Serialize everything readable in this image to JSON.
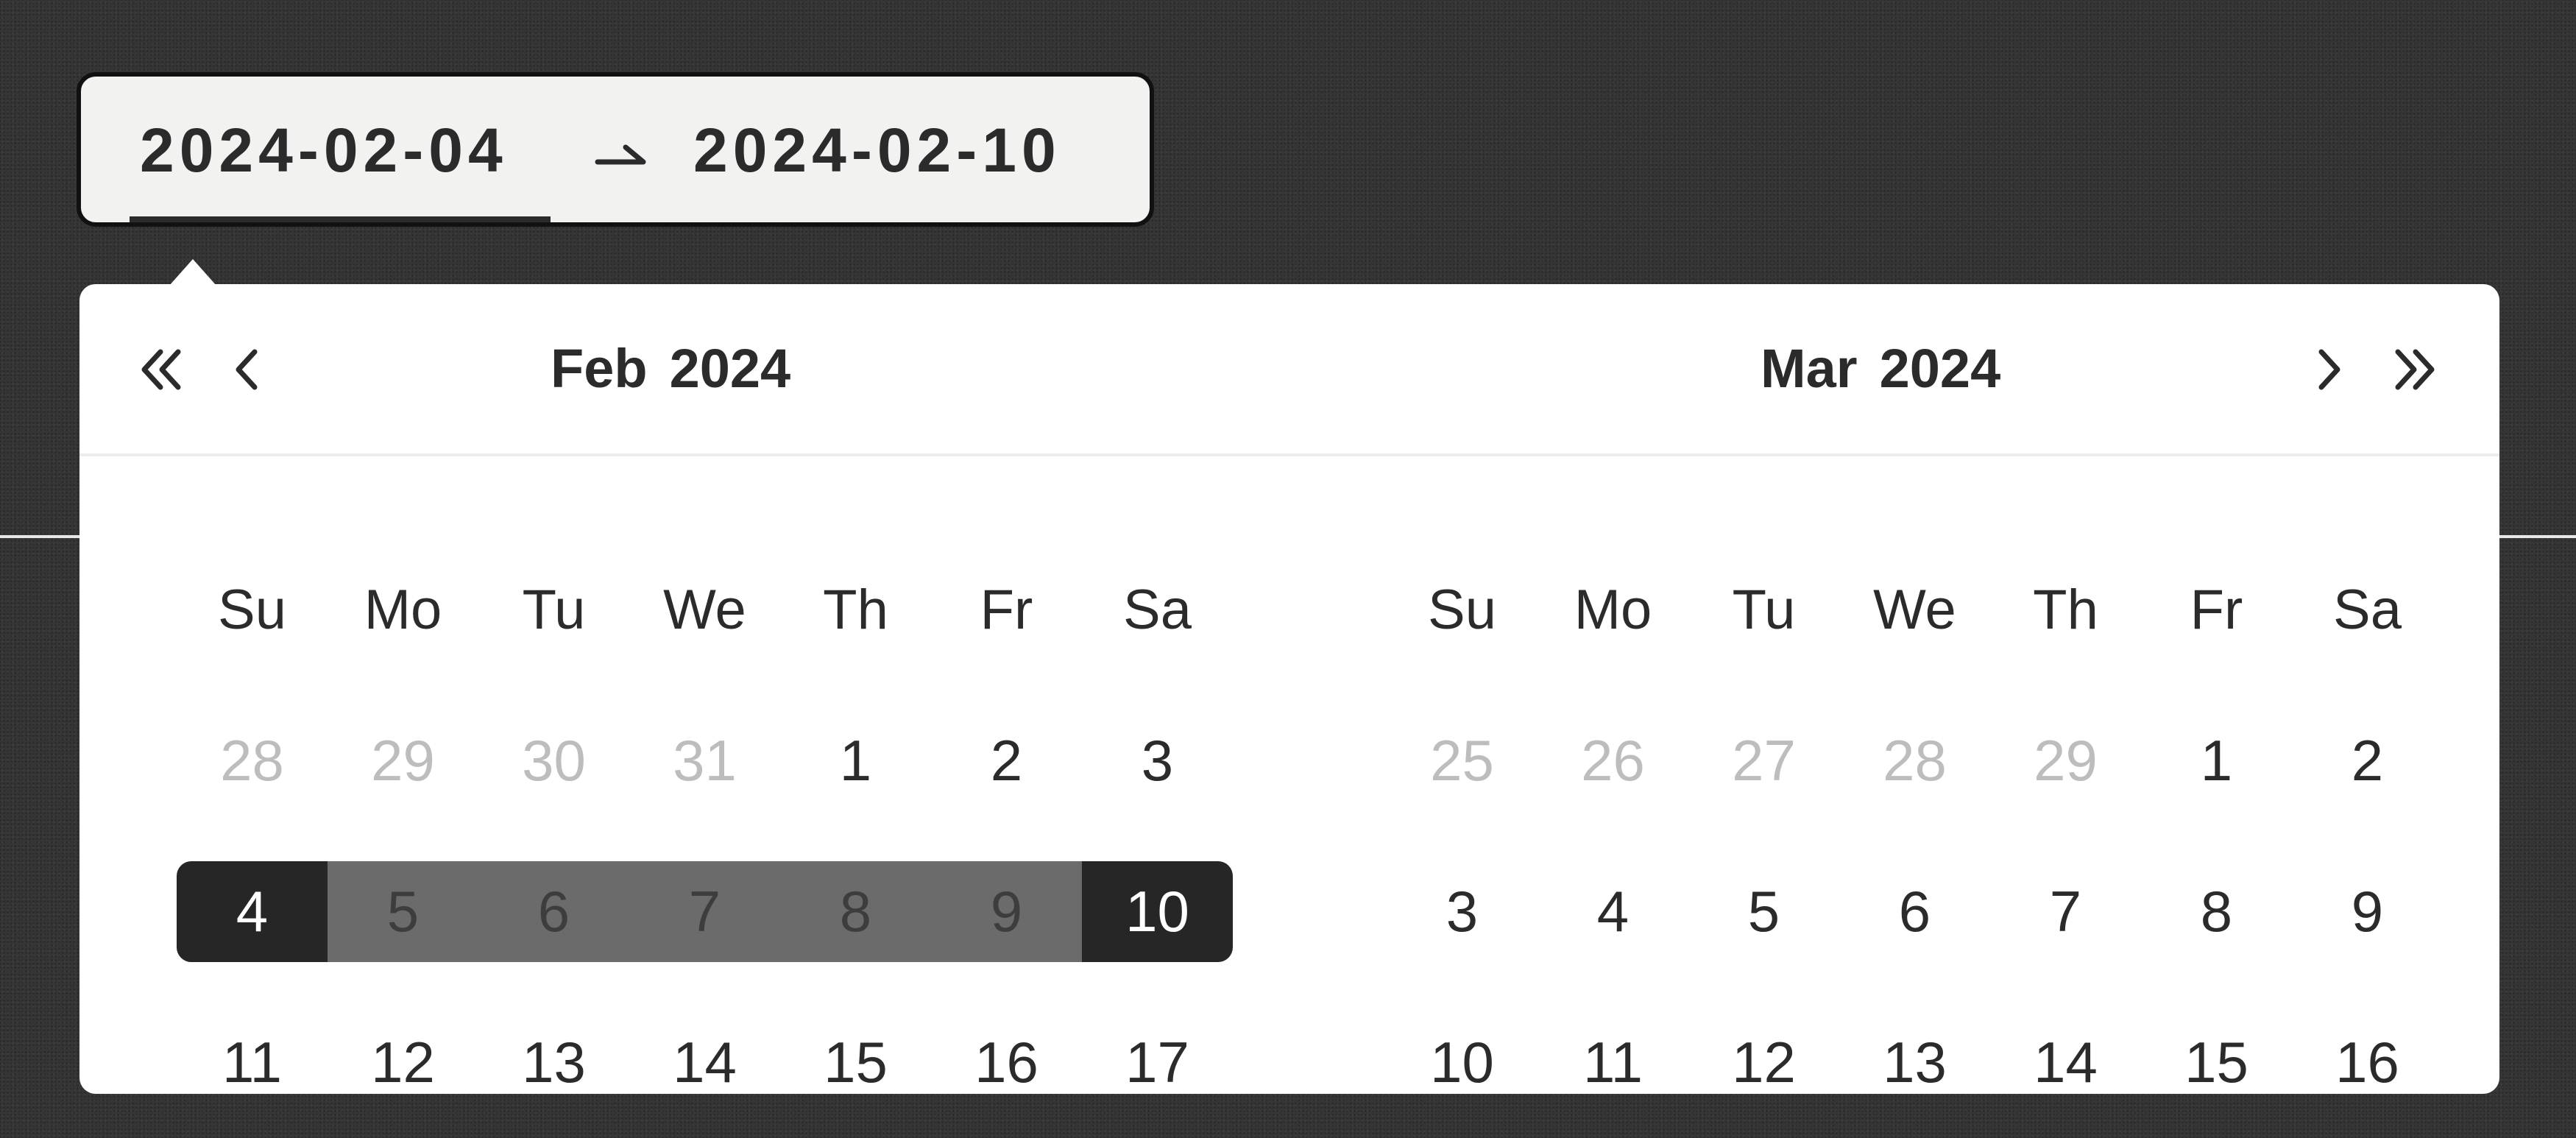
{
  "range_input": {
    "start_value": "2024-02-04",
    "separator": "⇀",
    "end_value": "2024-02-10"
  },
  "nav": {
    "prev_year_icon": "double-chevron-left-icon",
    "prev_month_icon": "chevron-left-icon",
    "next_month_icon": "chevron-right-icon",
    "next_year_icon": "double-chevron-right-icon"
  },
  "left_calendar": {
    "month": "Feb",
    "year": "2024",
    "weekdays": [
      "Su",
      "Mo",
      "Tu",
      "We",
      "Th",
      "Fr",
      "Sa"
    ],
    "weeks": [
      [
        {
          "d": "28",
          "s": "muted"
        },
        {
          "d": "29",
          "s": "muted"
        },
        {
          "d": "30",
          "s": "muted"
        },
        {
          "d": "31",
          "s": "muted"
        },
        {
          "d": "1",
          "s": ""
        },
        {
          "d": "2",
          "s": ""
        },
        {
          "d": "3",
          "s": ""
        }
      ],
      [
        {
          "d": "4",
          "s": "start"
        },
        {
          "d": "5",
          "s": "in-range"
        },
        {
          "d": "6",
          "s": "in-range"
        },
        {
          "d": "7",
          "s": "in-range"
        },
        {
          "d": "8",
          "s": "in-range"
        },
        {
          "d": "9",
          "s": "in-range"
        },
        {
          "d": "10",
          "s": "end"
        }
      ],
      [
        {
          "d": "11",
          "s": ""
        },
        {
          "d": "12",
          "s": ""
        },
        {
          "d": "13",
          "s": ""
        },
        {
          "d": "14",
          "s": ""
        },
        {
          "d": "15",
          "s": ""
        },
        {
          "d": "16",
          "s": ""
        },
        {
          "d": "17",
          "s": ""
        }
      ]
    ]
  },
  "right_calendar": {
    "month": "Mar",
    "year": "2024",
    "weekdays": [
      "Su",
      "Mo",
      "Tu",
      "We",
      "Th",
      "Fr",
      "Sa"
    ],
    "weeks": [
      [
        {
          "d": "25",
          "s": "muted"
        },
        {
          "d": "26",
          "s": "muted"
        },
        {
          "d": "27",
          "s": "muted"
        },
        {
          "d": "28",
          "s": "muted"
        },
        {
          "d": "29",
          "s": "muted"
        },
        {
          "d": "1",
          "s": ""
        },
        {
          "d": "2",
          "s": ""
        }
      ],
      [
        {
          "d": "3",
          "s": ""
        },
        {
          "d": "4",
          "s": ""
        },
        {
          "d": "5",
          "s": ""
        },
        {
          "d": "6",
          "s": ""
        },
        {
          "d": "7",
          "s": ""
        },
        {
          "d": "8",
          "s": ""
        },
        {
          "d": "9",
          "s": ""
        }
      ],
      [
        {
          "d": "10",
          "s": ""
        },
        {
          "d": "11",
          "s": ""
        },
        {
          "d": "12",
          "s": ""
        },
        {
          "d": "13",
          "s": ""
        },
        {
          "d": "14",
          "s": ""
        },
        {
          "d": "15",
          "s": ""
        },
        {
          "d": "16",
          "s": ""
        }
      ]
    ]
  },
  "colors": {
    "range_fill": "#6b6b6b",
    "selected_fill": "#262626",
    "muted_text": "#bdbdbd"
  }
}
